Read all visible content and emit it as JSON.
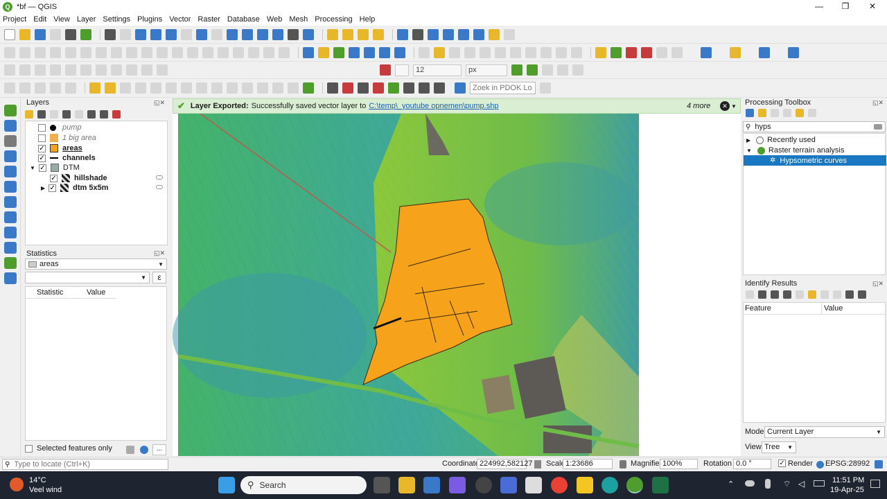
{
  "window": {
    "title": "*bf — QGIS",
    "minimize": "—",
    "maximize": "❐",
    "close": "✕"
  },
  "menu": [
    "Project",
    "Edit",
    "View",
    "Layer",
    "Settings",
    "Plugins",
    "Vector",
    "Raster",
    "Database",
    "Web",
    "Mesh",
    "Processing",
    "Help"
  ],
  "toolbar3": {
    "size_value": "12",
    "unit": "px"
  },
  "toolbar4": {
    "search_placeholder": "Zoek in PDOK Lo..."
  },
  "layers_panel": {
    "title": "Layers",
    "items": [
      {
        "label": "pump",
        "checked": false,
        "style": "italic-gray"
      },
      {
        "label": "1 big area",
        "checked": false,
        "style": "italic-gray"
      },
      {
        "label": "areas",
        "checked": true,
        "style": "bold"
      },
      {
        "label": "channels",
        "checked": true,
        "style": "bold"
      },
      {
        "label": "DTM",
        "checked": true,
        "style": "group"
      },
      {
        "label": "hillshade",
        "checked": true,
        "style": "bold"
      },
      {
        "label": "dtm 5x5m",
        "checked": true,
        "style": "bold"
      }
    ]
  },
  "statistics_panel": {
    "title": "Statistics",
    "layer": "areas",
    "columns": [
      "Statistic",
      "Value"
    ],
    "selected_only_label": "Selected features only",
    "more_button": "..."
  },
  "message_bar": {
    "heading": "Layer Exported:",
    "text": "Successfully saved vector layer to",
    "link": "C:\\temp\\_youtube opnemen\\pump.shp",
    "more": "4 more"
  },
  "processing_toolbox": {
    "title": "Processing Toolbox",
    "search_value": "hyps",
    "items": [
      {
        "label": "Recently used",
        "level": 0
      },
      {
        "label": "Raster terrain analysis",
        "level": 0
      },
      {
        "label": "Hypsometric curves",
        "level": 1,
        "selected": true
      }
    ]
  },
  "identify_results": {
    "title": "Identify Results",
    "columns": [
      "Feature",
      "Value"
    ],
    "mode_label": "Mode",
    "mode_value": "Current Layer",
    "view_label": "View",
    "view_value": "Tree"
  },
  "statusbar": {
    "locate_placeholder": "Type to locate (Ctrl+K)",
    "coordinate_label": "Coordinate",
    "coordinate_value": "224992,582127",
    "scale_label": "Scale",
    "scale_value": "1:23686",
    "magnifier_label": "Magnifier",
    "magnifier_value": "100%",
    "rotation_label": "Rotation",
    "rotation_value": "0.0 °",
    "render_label": "Render",
    "crs": "EPSG:28992"
  },
  "taskbar": {
    "weather_temp": "14°C",
    "weather_desc": "Veel wind",
    "search_label": "Search",
    "time": "11:51 PM",
    "date": "19-Apr-25"
  },
  "colors": {
    "accent": "#4f9d2d",
    "selection": "#1a78c2",
    "area_fill": "#f7a21b"
  }
}
